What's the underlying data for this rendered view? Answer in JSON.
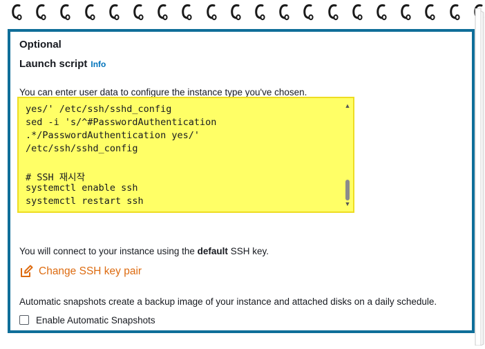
{
  "section": {
    "optional_label": "Optional",
    "launch_script_label": "Launch script",
    "info_link": "Info"
  },
  "script": {
    "helper_text": "You can enter user data to configure the instance type you've chosen.",
    "lines": [
      "yes/' /etc/ssh/sshd_config",
      "sed -i 's/^#PasswordAuthentication",
      ".*/PasswordAuthentication yes/'",
      "/etc/ssh/sshd_config",
      "",
      "# SSH 재시작",
      "systemctl enable ssh",
      "systemctl restart ssh"
    ],
    "highlight_color": "#ffff66"
  },
  "ssh": {
    "connect_prefix": "You will connect to your instance using the ",
    "connect_bold": "default",
    "connect_suffix": " SSH key.",
    "change_key_label": "Change SSH key pair",
    "icon": "edit-icon"
  },
  "snapshots": {
    "description": "Automatic snapshots create a backup image of your instance and attached disks on a daily schedule.",
    "checkbox_label": "Enable Automatic Snapshots",
    "checked": false
  },
  "colors": {
    "frame": "#0f6e99",
    "link": "#0073bb",
    "action": "#dd6b10"
  }
}
